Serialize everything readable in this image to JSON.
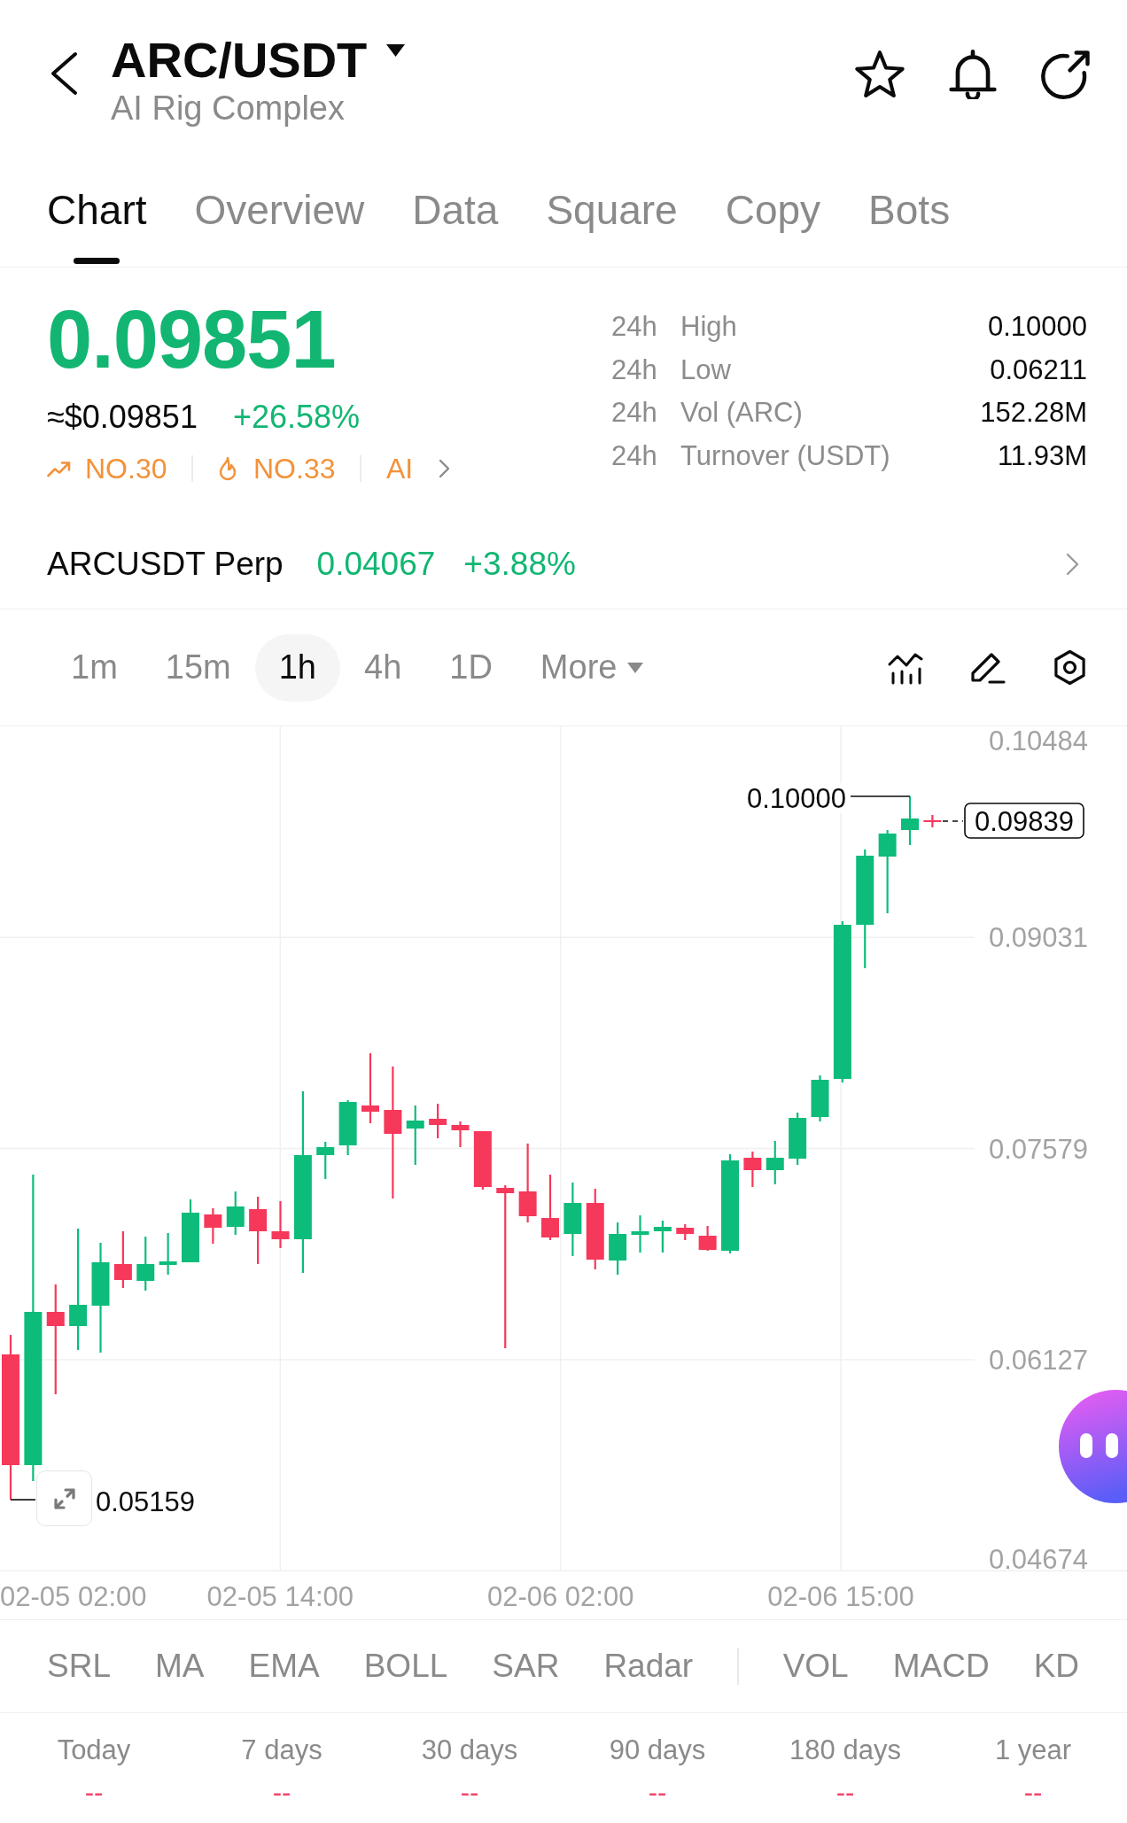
{
  "header": {
    "title": "ARC/USDT",
    "subtitle": "AI Rig Complex"
  },
  "tabs": [
    {
      "label": "Chart",
      "selected": true
    },
    {
      "label": "Overview",
      "selected": false
    },
    {
      "label": "Data",
      "selected": false
    },
    {
      "label": "Square",
      "selected": false
    },
    {
      "label": "Copy",
      "selected": false
    },
    {
      "label": "Bots",
      "selected": false
    }
  ],
  "ticker": {
    "price": "0.09851",
    "fiat_price": "≈$0.09851",
    "change": "+26.58%",
    "tags": [
      {
        "kind": "trend",
        "label": "NO.30"
      },
      {
        "kind": "hot",
        "label": "NO.33"
      },
      {
        "kind": "topic",
        "label": "AI"
      }
    ]
  },
  "stats": [
    {
      "period": "24h",
      "label": "High",
      "value": "0.10000"
    },
    {
      "period": "24h",
      "label": "Low",
      "value": "0.06211"
    },
    {
      "period": "24h",
      "label": "Vol (ARC)",
      "value": "152.28M"
    },
    {
      "period": "24h",
      "label": "Turnover (USDT)",
      "value": "11.93M"
    }
  ],
  "perpetual": {
    "name": "ARCUSDT Perp",
    "price": "0.04067",
    "change": "+3.88%"
  },
  "intervals": [
    {
      "kind": "preset",
      "label": "1m",
      "selected": false
    },
    {
      "kind": "preset",
      "label": "15m",
      "selected": false
    },
    {
      "kind": "preset",
      "label": "1h",
      "selected": true
    },
    {
      "kind": "preset",
      "label": "4h",
      "selected": false
    },
    {
      "kind": "preset",
      "label": "1D",
      "selected": false
    },
    {
      "kind": "menu",
      "label": "More",
      "selected": false
    }
  ],
  "chart": {
    "price_axis": [
      "0.10484",
      "0.09031",
      "0.07579",
      "0.06127",
      "0.04674"
    ],
    "time_axis": [
      "02-05 02:00",
      "02-05 14:00",
      "02-06 02:00",
      "02-06 15:00"
    ],
    "high_label": "0.10000",
    "low_label": "0.05159",
    "last_price": "0.09839"
  },
  "indicators": {
    "main": [
      "SRL",
      "MA",
      "EMA",
      "BOLL",
      "SAR",
      "Radar"
    ],
    "sub": [
      "VOL",
      "MACD",
      "KD"
    ]
  },
  "returns": [
    {
      "period": "Today",
      "value": "--"
    },
    {
      "period": "7 days",
      "value": "--"
    },
    {
      "period": "30 days",
      "value": "--"
    },
    {
      "period": "90 days",
      "value": "--"
    },
    {
      "period": "180 days",
      "value": "--"
    },
    {
      "period": "1 year",
      "value": "--"
    }
  ]
}
